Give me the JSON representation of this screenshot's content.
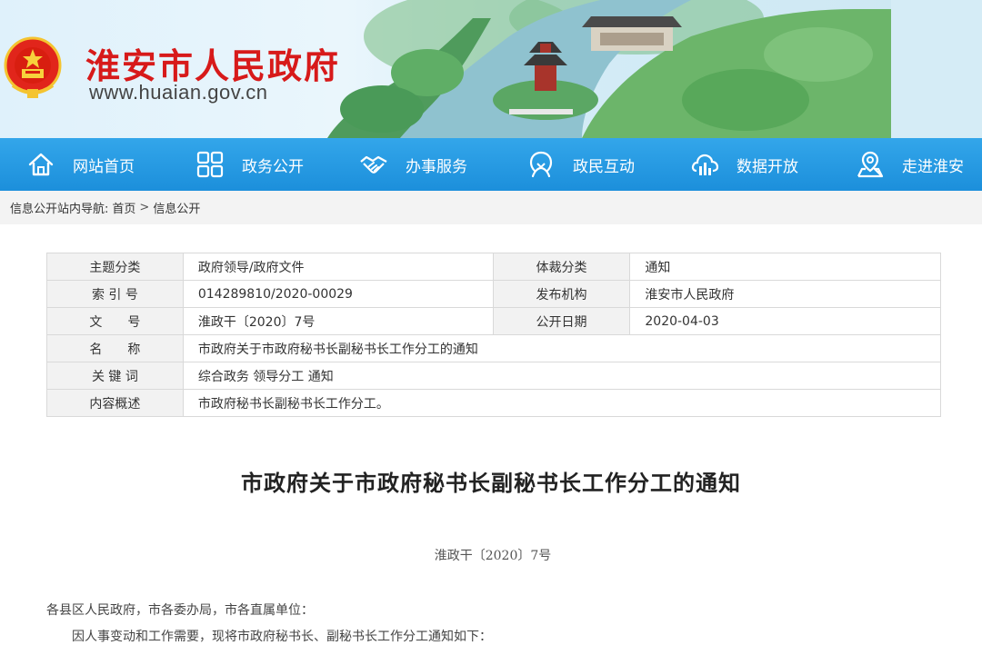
{
  "header": {
    "site_title": "淮安市人民政府",
    "site_url": "www.huaian.gov.cn",
    "emblem_icon": "national-emblem"
  },
  "nav": {
    "items": [
      {
        "label": "网站首页",
        "icon": "home-icon"
      },
      {
        "label": "政务公开",
        "icon": "grid-icon"
      },
      {
        "label": "办事服务",
        "icon": "handshake-icon"
      },
      {
        "label": "政民互动",
        "icon": "interaction-icon"
      },
      {
        "label": "数据开放",
        "icon": "data-icon"
      },
      {
        "label": "走进淮安",
        "icon": "location-icon"
      }
    ]
  },
  "breadcrumb": {
    "prefix": "信息公开站内导航:",
    "home": "首页",
    "separator": ">",
    "current": "信息公开"
  },
  "info": {
    "rows": [
      {
        "k1": "主题分类",
        "v1": "政府领导/政府文件",
        "k2": "体裁分类",
        "v2": "通知"
      },
      {
        "k1": "索 引 号",
        "v1": "014289810/2020-00029",
        "k2": "发布机构",
        "v2": "淮安市人民政府"
      },
      {
        "k1": "文　　号",
        "v1": "淮政干〔2020〕7号",
        "k2": "公开日期",
        "v2": "2020-04-03"
      }
    ],
    "wide_rows": [
      {
        "k": "名　　称",
        "v": "市政府关于市政府秘书长副秘书长工作分工的通知"
      },
      {
        "k": "关 键 词",
        "v": "综合政务 领导分工 通知"
      },
      {
        "k": "内容概述",
        "v": "市政府秘书长副秘书长工作分工。"
      }
    ]
  },
  "article": {
    "title": "市政府关于市政府秘书长副秘书长工作分工的通知",
    "doc_no": "淮政干〔2020〕7号",
    "para1": "各县区人民政府，市各委办局，市各直属单位：",
    "para2": "因人事变动和工作需要，现将市政府秘书长、副秘书长工作分工通知如下："
  },
  "colors": {
    "title_red": "#d71a1a",
    "nav_blue": "#1c8fdb",
    "crumb_bg": "#f3f3f3",
    "table_key_bg": "#f2f2f2"
  }
}
